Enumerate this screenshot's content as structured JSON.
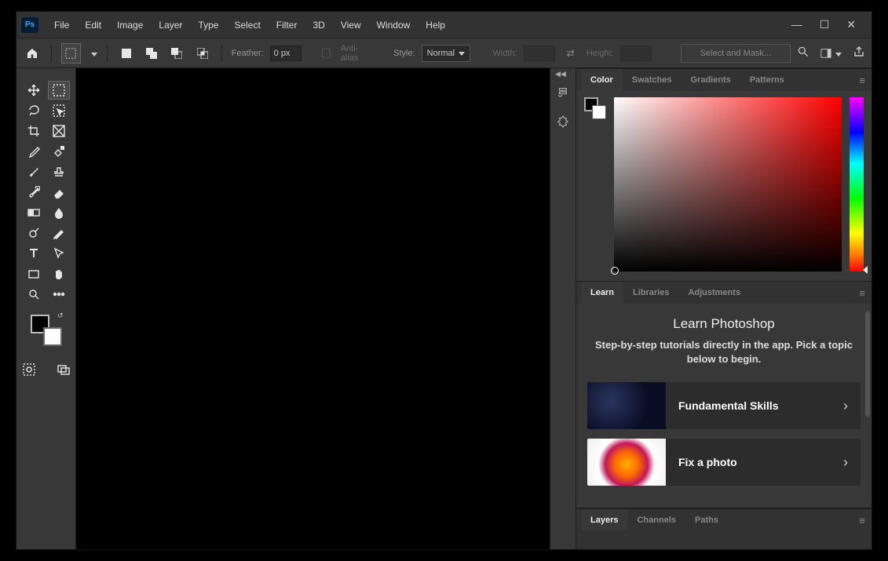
{
  "app_logo_text": "Ps",
  "menu": [
    "File",
    "Edit",
    "Image",
    "Layer",
    "Type",
    "Select",
    "Filter",
    "3D",
    "View",
    "Window",
    "Help"
  ],
  "optionbar": {
    "feather_label": "Feather:",
    "feather_value": "0 px",
    "antialias_label": "Anti-alias",
    "style_label": "Style:",
    "style_value": "Normal",
    "width_label": "Width:",
    "width_value": "",
    "height_label": "Height:",
    "height_value": "",
    "mask_button": "Select and Mask..."
  },
  "color_panel": {
    "tabs": [
      "Color",
      "Swatches",
      "Gradients",
      "Patterns"
    ],
    "active_tab": 0,
    "foreground": "#000000",
    "background": "#ffffff",
    "hue_deg": 0
  },
  "learn_panel": {
    "tabs": [
      "Learn",
      "Libraries",
      "Adjustments"
    ],
    "active_tab": 0,
    "title": "Learn Photoshop",
    "subtitle": "Step-by-step tutorials directly in the app. Pick a topic below to begin.",
    "tutorials": [
      {
        "label": "Fundamental Skills",
        "thumb": "dark"
      },
      {
        "label": "Fix a photo",
        "thumb": "flowers"
      }
    ]
  },
  "layers_panel": {
    "tabs": [
      "Layers",
      "Channels",
      "Paths"
    ],
    "active_tab": 0
  },
  "tools_left": [
    [
      "move",
      "marquee-rect"
    ],
    [
      "lasso",
      "quick-select"
    ],
    [
      "crop",
      "frame"
    ],
    [
      "eyedropper",
      "healing"
    ],
    [
      "brush",
      "stamp"
    ],
    [
      "history-brush",
      "eraser"
    ],
    [
      "gradient",
      "blur"
    ],
    [
      "dodge",
      "pen"
    ],
    [
      "type",
      "path-select"
    ],
    [
      "rectangle",
      "hand"
    ],
    [
      "zoom",
      "more"
    ]
  ],
  "selected_tool": "marquee-rect",
  "toolfooter": [
    "quickmask",
    "screenmode"
  ]
}
